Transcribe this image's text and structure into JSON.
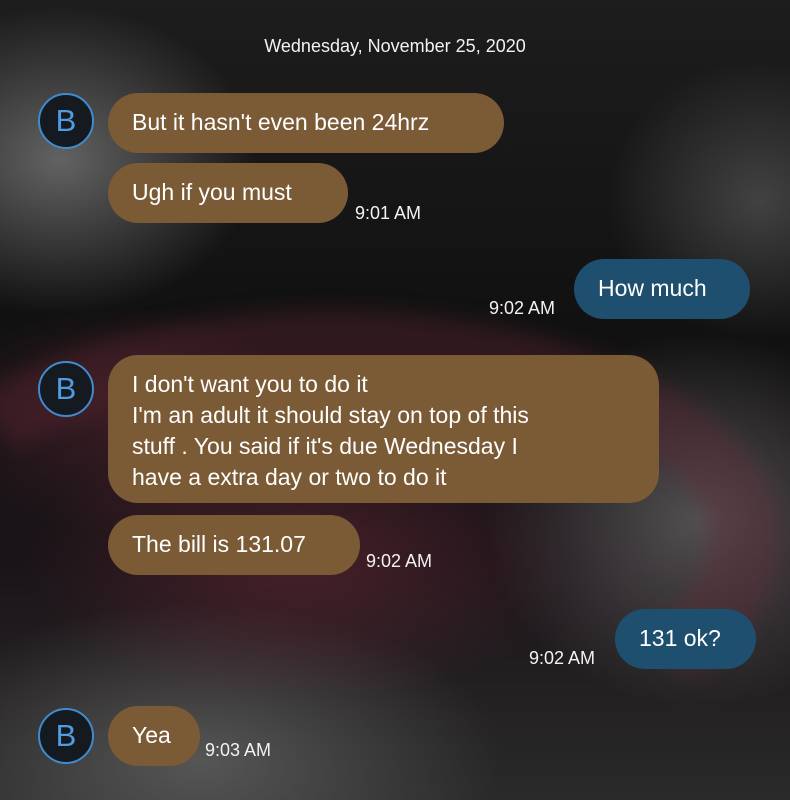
{
  "conversation": {
    "date_header": "Wednesday, November 25, 2020",
    "contact_initial": "B",
    "messages": [
      {
        "text": "But it hasn't even been 24hrz"
      },
      {
        "text": "Ugh if you must",
        "time": "9:01 AM"
      },
      {
        "text": "How much",
        "time": "9:02 AM"
      },
      {
        "lines": [
          "I don't want  you to do it",
          "I'm an adult it should stay on top of this",
          "stuff . You said if it's due Wednesday I",
          "have a extra day or two to do it"
        ]
      },
      {
        "text": "The bill is 131.07",
        "time": "9:02 AM"
      },
      {
        "text": "131 ok?",
        "time": "9:02 AM"
      },
      {
        "text": "Yea",
        "time": "9:03 AM"
      }
    ]
  },
  "colors": {
    "incoming_bubble": "#7b5a36",
    "outgoing_bubble": "#1f4f6e",
    "avatar_accent": "#3f8bd0"
  }
}
